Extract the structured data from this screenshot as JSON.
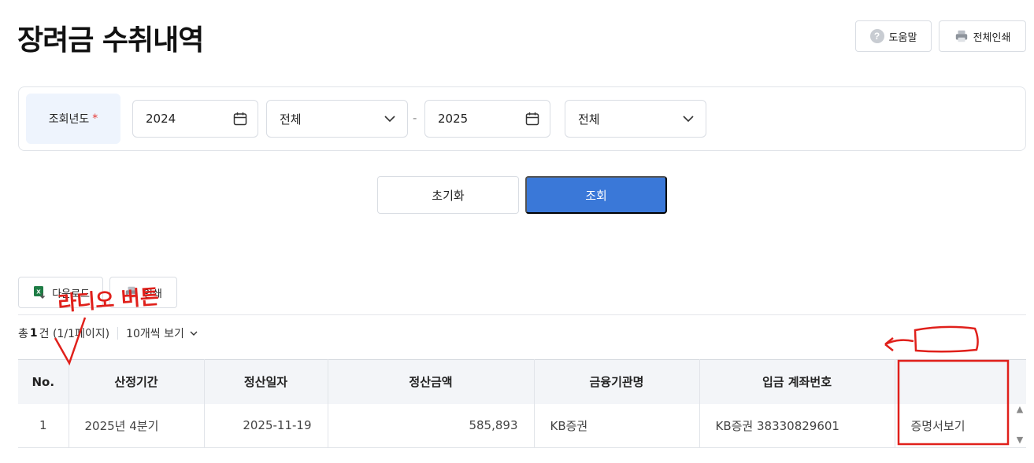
{
  "header": {
    "title": "장려금 수취내역",
    "help_label": "도움말",
    "print_all_label": "전체인쇄"
  },
  "search": {
    "year_label": "조회년도",
    "required_mark": "*",
    "from_year": "2024",
    "from_period": "전체",
    "separator": "-",
    "to_year": "2025",
    "to_period": "전체"
  },
  "actions": {
    "reset_label": "초기화",
    "search_label": "조회"
  },
  "toolbar": {
    "download_label": "다운로드",
    "print_label": "인쇄"
  },
  "summary": {
    "prefix": "총",
    "count": "1",
    "suffix": "건 (1/1페이지)",
    "per_page": "10개씩 보기"
  },
  "table": {
    "headers": [
      "No.",
      "산정기간",
      "정산일자",
      "정산금액",
      "금융기관명",
      "입금 계좌번호",
      ""
    ],
    "rows": [
      [
        "1",
        "2025년 4분기",
        "2025-11-19",
        "585,893",
        "KB증권",
        "KB증권 38330829601",
        "증명서보기"
      ]
    ]
  },
  "annotation": {
    "handwritten_text": "라디오 버튼",
    "color": "#e0201b"
  },
  "colors": {
    "primary": "#3a78d8",
    "label_bg": "#eef4fd",
    "required": "#e53935",
    "excel": "#1e7c45"
  }
}
